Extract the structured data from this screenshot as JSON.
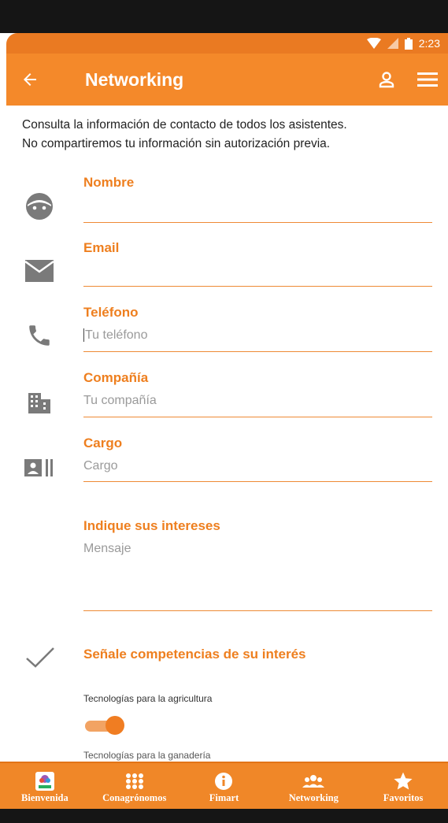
{
  "status": {
    "time": "2:23"
  },
  "appbar": {
    "title": "Networking"
  },
  "intro": {
    "line1": "Consulta la información de contacto de todos los asistentes.",
    "line2": "No compartiremos tu información sin autorización previa."
  },
  "form": {
    "nombre": {
      "label": "Nombre",
      "value": ""
    },
    "email": {
      "label": "Email",
      "value": ""
    },
    "telefono": {
      "label": "Teléfono",
      "placeholder": "Tu teléfono"
    },
    "compania": {
      "label": "Compañía",
      "placeholder": "Tu compañía"
    },
    "cargo": {
      "label": "Cargo",
      "placeholder": "Cargo"
    },
    "intereses": {
      "label": "Indique sus intereses",
      "placeholder": "Mensaje"
    }
  },
  "competencias": {
    "title": "Señale competencias de su interés",
    "options": [
      {
        "label": "Tecnologías para la agricultura",
        "checked": true
      },
      {
        "label": "Tecnologías para la ganadería"
      }
    ]
  },
  "nav": [
    {
      "label": "Bienvenida",
      "icon": "logo-icon"
    },
    {
      "label": "Conagrónomos",
      "icon": "grid-icon"
    },
    {
      "label": "Fimart",
      "icon": "info-icon"
    },
    {
      "label": "Networking",
      "icon": "people-icon"
    },
    {
      "label": "Favoritos",
      "icon": "star-icon"
    }
  ],
  "colors": {
    "primary": "#f4892a",
    "accent": "#ee7f1f"
  }
}
